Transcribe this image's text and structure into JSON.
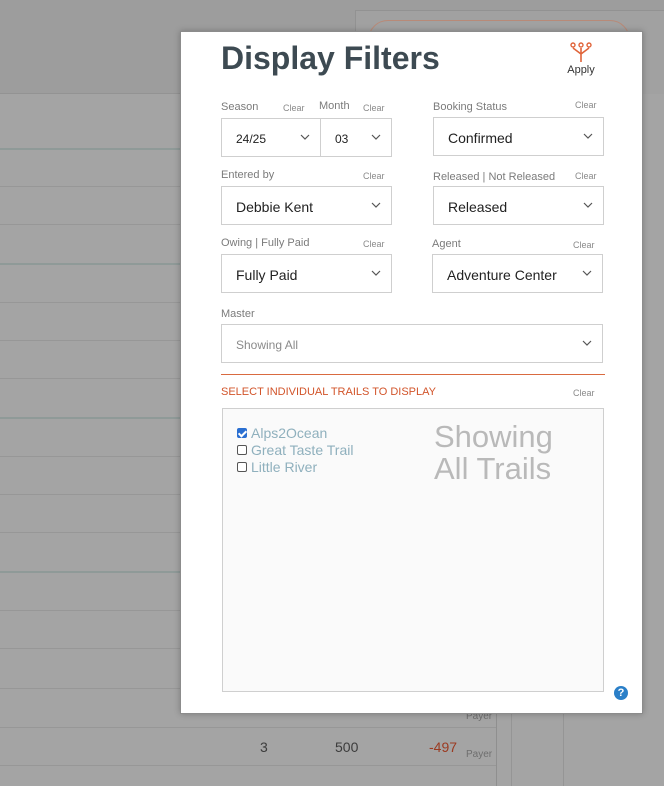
{
  "modal": {
    "title": "Display Filters",
    "apply_label": "Apply",
    "clear_label": "Clear",
    "fields": {
      "season": {
        "label": "Season",
        "value": "24/25"
      },
      "month": {
        "label": "Month",
        "value": "03"
      },
      "booking_status": {
        "label": "Booking Status",
        "value": "Confirmed"
      },
      "entered_by": {
        "label": "Entered by",
        "value": "Debbie Kent"
      },
      "released": {
        "label": "Released | Not Released",
        "value": "Released"
      },
      "owing": {
        "label": "Owing | Fully Paid",
        "value": "Fully Paid"
      },
      "agent": {
        "label": "Agent",
        "value": "Adventure Center"
      },
      "master": {
        "label": "Master",
        "value": "Showing All"
      }
    },
    "trails_section": {
      "title": "SELECT INDIVIDUAL TRAILS TO DISPLAY",
      "trails": [
        {
          "label": "Alps2Ocean",
          "checked": true
        },
        {
          "label": "Great Taste Trail",
          "checked": false
        },
        {
          "label": "Little River",
          "checked": false
        }
      ],
      "status_line1": "Showing",
      "status_line2": "All Trails"
    },
    "help_label": "?"
  },
  "background": {
    "row_a": {
      "qty": "",
      "amount": "",
      "balance": "",
      "note": "Payer"
    },
    "row_b": {
      "qty": "3",
      "amount": "500",
      "balance": "-497",
      "note": "Payer"
    }
  },
  "colors": {
    "accent": "#d2542a",
    "trail_text": "#8fb0bd",
    "help": "#2a7fc8",
    "checkbox": "#2a6fd1"
  }
}
